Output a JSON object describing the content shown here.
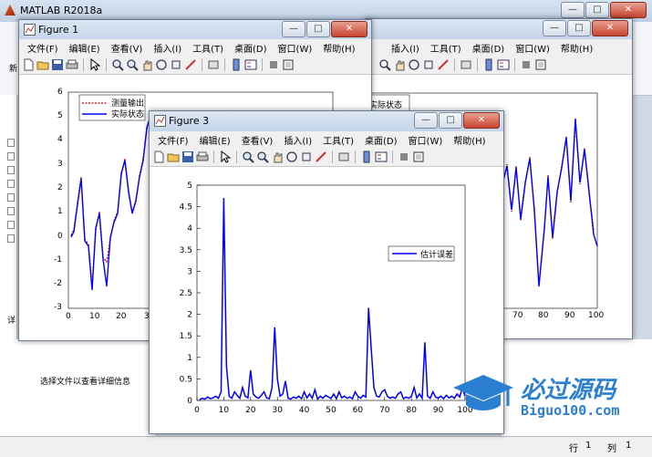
{
  "matlab": {
    "title": "MATLAB R2018a",
    "status_hint": "选择文件以查看详细信息",
    "status_row_label": "行",
    "status_row_value": "1",
    "status_col_label": "列",
    "status_col_value": "1",
    "left_stub": "新",
    "left_stub2": "详"
  },
  "menus": [
    "文件(F)",
    "编辑(E)",
    "查看(V)",
    "插入(I)",
    "工具(T)",
    "桌面(D)",
    "窗口(W)",
    "帮助(H)"
  ],
  "window_controls": {
    "minimize": "—",
    "maximize": "□",
    "close": "✕"
  },
  "figure1": {
    "title": "Figure 1",
    "legend": [
      "测量输出",
      "实际状态"
    ],
    "right_legend_fragment": "实际状态",
    "yticks_left": [
      "6",
      "5",
      "4",
      "3",
      "2",
      "1",
      "0",
      "-1",
      "-2",
      "-3"
    ],
    "xticks_left": [
      "0",
      "10",
      "20",
      "3"
    ],
    "xticks_right": [
      "70",
      "80",
      "90",
      "100"
    ]
  },
  "figure3": {
    "title": "Figure 3",
    "legend": "估计误差"
  },
  "watermark": {
    "cn": "必过源码",
    "en": "Biguo100.com"
  },
  "colors": {
    "blue": "#0000ff",
    "red": "#cc0000"
  },
  "chart_data": {
    "type": "line",
    "title": "",
    "xlabel": "",
    "ylabel": "",
    "xlim": [
      0,
      100
    ],
    "ylim": [
      0,
      5
    ],
    "xticks": [
      "0",
      "10",
      "20",
      "30",
      "40",
      "50",
      "60",
      "70",
      "80",
      "90",
      "100"
    ],
    "yticks": [
      "0",
      "0.5",
      "1",
      "1.5",
      "2",
      "2.5",
      "3",
      "3.5",
      "4",
      "4.5",
      "5"
    ],
    "legend_position": "right",
    "series": [
      {
        "name": "估计误差",
        "x": [
          1,
          2,
          3,
          4,
          5,
          6,
          7,
          8,
          9,
          10,
          11,
          12,
          13,
          14,
          15,
          16,
          17,
          18,
          19,
          20,
          21,
          22,
          23,
          24,
          25,
          26,
          27,
          28,
          29,
          30,
          31,
          32,
          33,
          34,
          35,
          36,
          37,
          38,
          39,
          40,
          41,
          42,
          43,
          44,
          45,
          46,
          47,
          48,
          49,
          50,
          51,
          52,
          53,
          54,
          55,
          56,
          57,
          58,
          59,
          60,
          61,
          62,
          63,
          64,
          65,
          66,
          67,
          68,
          69,
          70,
          71,
          72,
          73,
          74,
          75,
          76,
          77,
          78,
          79,
          80,
          81,
          82,
          83,
          84,
          85,
          86,
          87,
          88,
          89,
          90,
          91,
          92,
          93,
          94,
          95,
          96,
          97,
          98,
          99,
          100
        ],
        "values": [
          0.02,
          0.05,
          0.03,
          0.08,
          0.04,
          0.06,
          0.1,
          0.05,
          0.2,
          4.7,
          0.8,
          0.1,
          0.05,
          0.2,
          0.12,
          0.05,
          0.3,
          0.1,
          0.06,
          0.7,
          0.15,
          0.08,
          0.05,
          0.12,
          0.2,
          0.06,
          0.04,
          0.3,
          1.7,
          0.5,
          0.1,
          0.15,
          0.45,
          0.05,
          0.03,
          0.08,
          0.05,
          0.1,
          0.04,
          0.2,
          0.06,
          0.15,
          0.05,
          0.25,
          0.03,
          0.1,
          0.05,
          0.12,
          0.08,
          0.05,
          0.15,
          0.04,
          0.2,
          0.06,
          0.1,
          0.05,
          0.08,
          0.04,
          0.2,
          0.1,
          0.05,
          0.12,
          0.08,
          2.15,
          1.2,
          0.3,
          0.1,
          0.08,
          0.2,
          0.25,
          0.1,
          0.05,
          0.08,
          0.05,
          0.15,
          0.2,
          0.04,
          0.08,
          0.05,
          0.1,
          0.3,
          0.06,
          0.15,
          0.05,
          1.35,
          0.1,
          0.05,
          0.2,
          0.08,
          0.05,
          0.1,
          0.04,
          0.12,
          0.06,
          0.1,
          0.05,
          0.15,
          0.08,
          0.3,
          0.1
        ]
      }
    ]
  }
}
